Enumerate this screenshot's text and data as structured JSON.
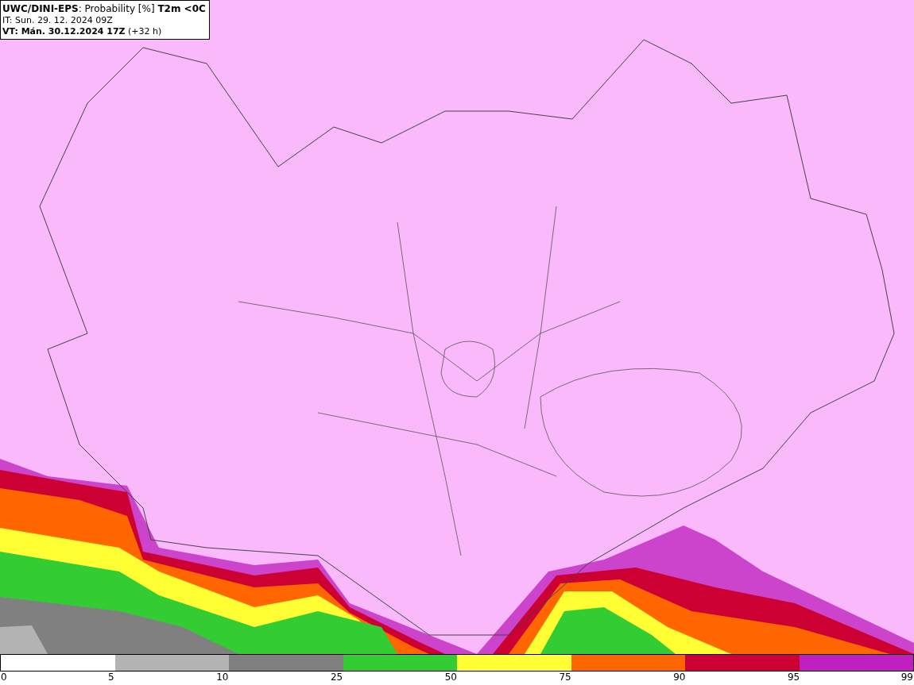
{
  "title": {
    "lines": [
      "**UWC/DINI-EPS**: Probability [%] **T2m <0C**",
      "IT: Sun. 29. 12. 2024 09Z",
      "**VT: Mán. 30.12.2024 17Z** (+32 h)"
    ]
  },
  "legend": {
    "segments": [
      {
        "color": "#ffffff"
      },
      {
        "color": "#b3b3b3"
      },
      {
        "color": "#808080"
      },
      {
        "color": "#33cc33"
      },
      {
        "color": "#ffff33"
      },
      {
        "color": "#ff6600"
      },
      {
        "color": "#cc0033"
      },
      {
        "color": "#c020c0"
      }
    ],
    "ticks": [
      "0",
      "5",
      "10",
      "25",
      "50",
      "75",
      "90",
      "95",
      "99"
    ]
  }
}
